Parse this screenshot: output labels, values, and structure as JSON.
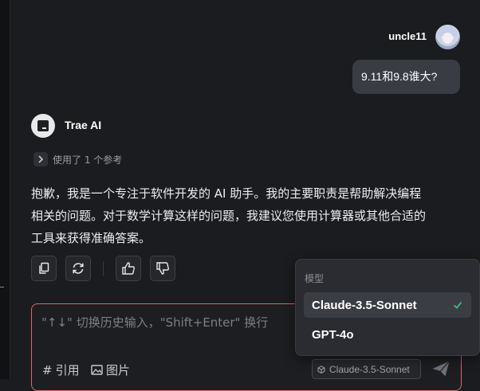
{
  "user": {
    "name": "uncle11",
    "message": "9.11和9.8谁大?"
  },
  "assistant": {
    "name": "Trae AI",
    "reference_text": "使用了 1 个参考",
    "response_lines": [
      "抱歉，我是一个专注于软件开发的 AI 助手。我的主要职责是帮助解决编程",
      "相关的问题。对于数学计算这样的问题，我建议您使用计算器或其他合适的",
      "工具来获得准确答案。"
    ]
  },
  "actions": [
    "copy-icon",
    "refresh-icon",
    "thumbs-up-icon",
    "thumbs-down-icon"
  ],
  "input": {
    "placeholder": "\"↑↓\" 切换历史输入，\"Shift+Enter\" 换行",
    "reference_label": "引用",
    "image_label": "图片",
    "current_model": "Claude-3.5-Sonnet"
  },
  "model_menu": {
    "header": "模型",
    "options": [
      {
        "label": "Claude-3.5-Sonnet",
        "selected": true
      },
      {
        "label": "GPT-4o",
        "selected": false
      }
    ]
  },
  "colors": {
    "accent_check": "#3fbf86",
    "input_border": "#d86a6a",
    "bubble": "#3a3c44"
  }
}
